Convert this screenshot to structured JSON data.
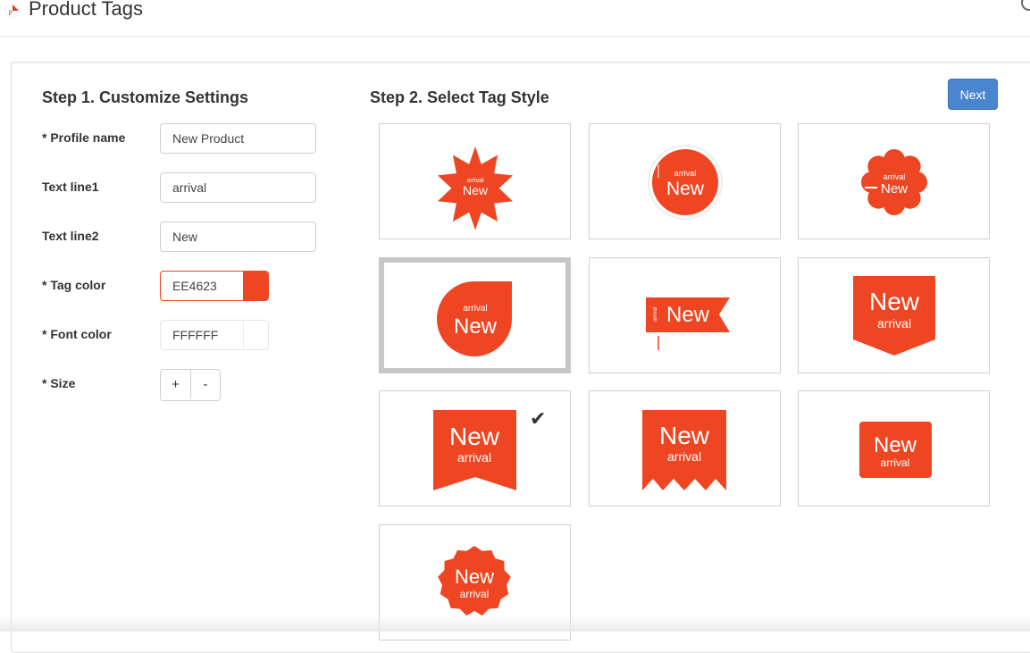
{
  "app": {
    "title": "Product Tags"
  },
  "step1": {
    "title": "Step 1. Customize Settings",
    "fields": {
      "profile_name": {
        "label": "* Profile name",
        "value": "New Product"
      },
      "text_line1": {
        "label": "Text line1",
        "value": "arrival"
      },
      "text_line2": {
        "label": "Text line2",
        "value": "New"
      },
      "tag_color": {
        "label": "* Tag color",
        "value": "EE4623"
      },
      "font_color": {
        "label": "* Font color",
        "value": "FFFFFF"
      },
      "size": {
        "label": "* Size",
        "increase": "+",
        "decrease": "-"
      }
    }
  },
  "step2": {
    "title": "Step 2. Select Tag Style",
    "next_label": "Next",
    "selected_style": "dropdrop",
    "checked_style": "ribbon-notch",
    "styles": [
      "burst",
      "circle",
      "flower",
      "drop",
      "flag",
      "shield",
      "ribbon-notch",
      "ribbon-zigzag",
      "rounded-rect",
      "seal"
    ]
  },
  "tag_preview": {
    "line1": "arrival",
    "line2": "New"
  },
  "colors": {
    "tag": "#EE4623",
    "font": "#FFFFFF",
    "accent": "#4A86CF"
  },
  "icons": {
    "check": "checkmark-icon"
  }
}
